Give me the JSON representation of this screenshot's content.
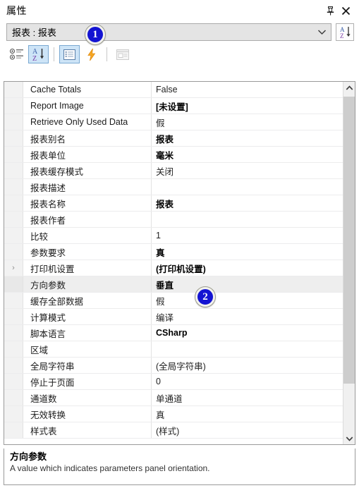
{
  "window": {
    "title": "属性",
    "pin_icon": "pin-icon",
    "close_icon": "close-icon"
  },
  "object_selector": {
    "value": "报表 : 报表",
    "dropdown_icon": "chevron-down-icon",
    "sort_button_icon": "sort-az-icon"
  },
  "toolbar": {
    "items": [
      {
        "icon": "categorized-icon",
        "active": false,
        "disabled": false
      },
      {
        "icon": "sort-alphabetical-icon",
        "active": true,
        "disabled": false
      },
      {
        "icon": "properties-icon",
        "active": true,
        "disabled": false
      },
      {
        "icon": "events-lightning-icon",
        "active": false,
        "disabled": false
      },
      {
        "icon": "property-pages-icon",
        "active": false,
        "disabled": true
      }
    ]
  },
  "grid": {
    "rows": [
      {
        "expander": "",
        "name": "Cache Totals",
        "value": "False",
        "bold": false,
        "selected": false
      },
      {
        "expander": "",
        "name": "Report Image",
        "value": "[未设置]",
        "bold": true,
        "selected": false
      },
      {
        "expander": "",
        "name": "Retrieve Only Used Data",
        "value": "假",
        "bold": false,
        "selected": false
      },
      {
        "expander": "",
        "name": "报表别名",
        "value": "报表",
        "bold": true,
        "selected": false
      },
      {
        "expander": "",
        "name": "报表单位",
        "value": "毫米",
        "bold": true,
        "selected": false
      },
      {
        "expander": "",
        "name": "报表缓存模式",
        "value": "关闭",
        "bold": false,
        "selected": false
      },
      {
        "expander": "",
        "name": "报表描述",
        "value": "",
        "bold": false,
        "selected": false
      },
      {
        "expander": "",
        "name": "报表名称",
        "value": "报表",
        "bold": true,
        "selected": false
      },
      {
        "expander": "",
        "name": "报表作者",
        "value": "",
        "bold": false,
        "selected": false
      },
      {
        "expander": "",
        "name": "比较",
        "value": "1",
        "bold": false,
        "selected": false
      },
      {
        "expander": "",
        "name": "参数要求",
        "value": "真",
        "bold": true,
        "selected": false
      },
      {
        "expander": "›",
        "name": "打印机设置",
        "value": "(打印机设置)",
        "bold": true,
        "selected": false
      },
      {
        "expander": "",
        "name": "方向参数",
        "value": "垂直",
        "bold": true,
        "selected": true
      },
      {
        "expander": "",
        "name": "缓存全部数据",
        "value": "假",
        "bold": false,
        "selected": false
      },
      {
        "expander": "",
        "name": "计算模式",
        "value": "编译",
        "bold": false,
        "selected": false
      },
      {
        "expander": "",
        "name": "脚本语言",
        "value": "CSharp",
        "bold": true,
        "selected": false
      },
      {
        "expander": "",
        "name": "区域",
        "value": "",
        "bold": false,
        "selected": false
      },
      {
        "expander": "",
        "name": "全局字符串",
        "value": "(全局字符串)",
        "bold": false,
        "selected": false
      },
      {
        "expander": "",
        "name": "停止于页面",
        "value": "0",
        "bold": false,
        "selected": false
      },
      {
        "expander": "",
        "name": "通道数",
        "value": "单通道",
        "bold": false,
        "selected": false
      },
      {
        "expander": "",
        "name": "无效转换",
        "value": "真",
        "bold": false,
        "selected": false
      },
      {
        "expander": "",
        "name": "样式表",
        "value": "(样式)",
        "bold": false,
        "selected": false
      }
    ],
    "scroll_up_icon": "chevron-up-icon",
    "scroll_down_icon": "chevron-down-icon"
  },
  "description": {
    "title": "方向参数",
    "text": "A value which indicates parameters panel orientation."
  },
  "callouts": [
    {
      "id": "1",
      "label": "1"
    },
    {
      "id": "2",
      "label": "2"
    }
  ],
  "colors": {
    "badge": "#1414d2",
    "toolbar_active": "#cde4f7",
    "selection": "#eeeeee"
  }
}
